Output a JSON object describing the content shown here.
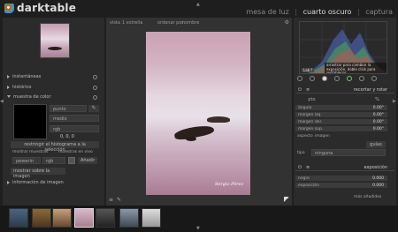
{
  "app": {
    "name": "darktable"
  },
  "views": [
    {
      "label": "mesa de luz",
      "active": false
    },
    {
      "label": "cuarto oscuro",
      "active": true
    },
    {
      "label": "captura",
      "active": false
    }
  ],
  "toolbar": {
    "view_label": "vista",
    "stars_value": "1 estrella",
    "sort_label": "ordenar por",
    "sort_value": "nombre"
  },
  "left_panel": {
    "items": [
      {
        "label": "instantáneas"
      },
      {
        "label": "histórico"
      },
      {
        "label": "muestra de color"
      }
    ],
    "picker": {
      "mode": "punto",
      "mean": "medio",
      "space": "rgb",
      "readout": "0, 0, 0",
      "restrict_button": "restringir el histograma a la selección",
      "display_samples": "mostrar muestras",
      "live_samples": "muestras en vivo",
      "preview_label": "pewerin",
      "preview_space": "rgb",
      "add_button": "Añadir",
      "display_on_image": "mostrar sobre la imagen"
    },
    "image_info": "información de imagen"
  },
  "center": {
    "signature": "Sergio Pérez"
  },
  "histogram": {
    "message": "arrastrar para cambiar la exposición, doble click para restablecer",
    "label": "Lab f"
  },
  "right_panel": {
    "module_icons": [
      "power-icon",
      "star-icon",
      "circle-icon",
      "half-circle-icon",
      "color-icon",
      "lens-icon",
      "effect-icon"
    ],
    "crop_module": {
      "title": "recortar y rotar",
      "tabs": [
        "pto",
        "",
        "%"
      ],
      "sliders": [
        {
          "label": "ángulo",
          "value": "0.00°"
        },
        {
          "label": "margen izq.",
          "value": "0.00°"
        },
        {
          "label": "margen der.",
          "value": "0.00°"
        },
        {
          "label": "margen sup.",
          "value": "0.00°"
        }
      ],
      "aspect_label": "aspecto",
      "aspect_value": "imagen",
      "guides_button": "guías",
      "tipo_label": "tipo",
      "tipo_value": "ninguna"
    },
    "exposure_module": {
      "title": "exposición",
      "sliders": [
        {
          "label": "negro",
          "value": "0.000"
        },
        {
          "label": "exposición",
          "value": "0.000"
        }
      ]
    },
    "more_modules": "más añadidos"
  },
  "filmstrip": {
    "count": 8
  }
}
